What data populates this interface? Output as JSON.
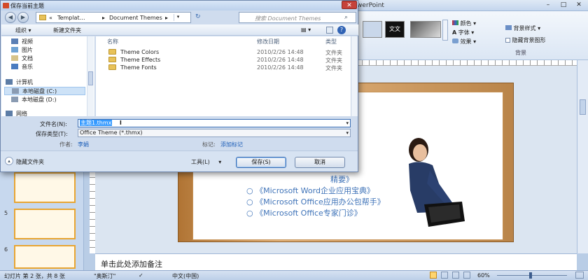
{
  "ppt": {
    "title": "werPoint",
    "ribbon": {
      "theme1": "文文",
      "colors": "颜色",
      "fonts": "字体",
      "effects": "效果",
      "bg_styles": "背景样式",
      "hide_bg": "隐藏背景图形",
      "bg_group": "背景"
    },
    "thumbs": [
      "5",
      "6"
    ],
    "bullets": [
      "精要》",
      "《Microsoft Word企业应用宝典》",
      "《Microsoft Office应用办公包帮手》",
      "《Microsoft Office专家门诊》"
    ],
    "notes": "单击此处添加备注",
    "status": {
      "slide": "幻灯片 第 2 张，共 8 张",
      "theme": "\"奥斯汀\"",
      "lang": "中文(中国)",
      "zoom": "60%"
    }
  },
  "dialog": {
    "title": "保存当前主题",
    "close": "✕",
    "breadcrumb": [
      "«",
      "Templat…",
      "Document Themes"
    ],
    "search_placeholder": "搜索 Document Themes",
    "toolbar": {
      "organize": "组织 ▾",
      "new_folder": "新建文件夹",
      "help": "?"
    },
    "nav_items": [
      {
        "label": "视频",
        "icon": "video-icon",
        "color": "#5a7fb5"
      },
      {
        "label": "图片",
        "icon": "pictures-icon",
        "color": "#6fa3d4"
      },
      {
        "label": "文档",
        "icon": "documents-icon",
        "color": "#d6c38a"
      },
      {
        "label": "音乐",
        "icon": "music-icon",
        "color": "#4a7cc0"
      },
      {
        "label": "计算机",
        "icon": "computer-icon",
        "color": "#5d7da6"
      },
      {
        "label": "本地磁盘 (C:)",
        "icon": "drive-icon",
        "color": "#8a9bb2"
      },
      {
        "label": "本地磁盘 (D:)",
        "icon": "drive-icon",
        "color": "#8a9bb2"
      },
      {
        "label": "网络",
        "icon": "network-icon",
        "color": "#5d7da6"
      }
    ],
    "columns": [
      "名称",
      "修改日期",
      "类型"
    ],
    "files": [
      {
        "name": "Theme Colors",
        "date": "2010/2/26 14:48",
        "type": "文件夹"
      },
      {
        "name": "Theme Effects",
        "date": "2010/2/26 14:48",
        "type": "文件夹"
      },
      {
        "name": "Theme Fonts",
        "date": "2010/2/26 14:48",
        "type": "文件夹"
      }
    ],
    "filename_label": "文件名(N):",
    "filename_value": "主题1.thmx",
    "savetype_label": "保存类型(T):",
    "savetype_value": "Office Theme (*.thmx)",
    "author_label": "作者:",
    "author_value": "李娟",
    "tags_label": "标记:",
    "tags_value": "添加标记",
    "hide_folders": "隐藏文件夹",
    "tools": "工具(L)",
    "save": "保存(S)",
    "cancel": "取消"
  }
}
